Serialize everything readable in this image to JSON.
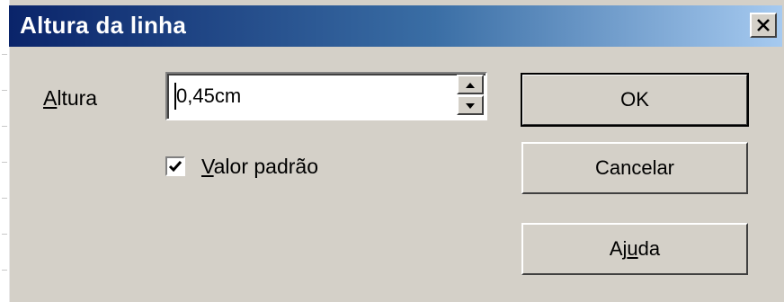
{
  "window": {
    "title": "Altura da linha",
    "close_symbol": "×"
  },
  "form": {
    "height_label_first": "A",
    "height_label_rest": "ltura",
    "height_value": "0,45cm",
    "default_checkbox": {
      "checked": true,
      "label_first": "V",
      "label_rest": "alor padrão"
    }
  },
  "buttons": {
    "ok_label": "OK",
    "cancel_label": "Cancelar",
    "help_label_pre": "Aj",
    "help_label_u": "u",
    "help_label_post": "da"
  },
  "icons": {
    "close": "close-icon",
    "spin_up": "arrow-up-icon",
    "spin_down": "arrow-down-icon",
    "check": "checkmark-icon"
  }
}
